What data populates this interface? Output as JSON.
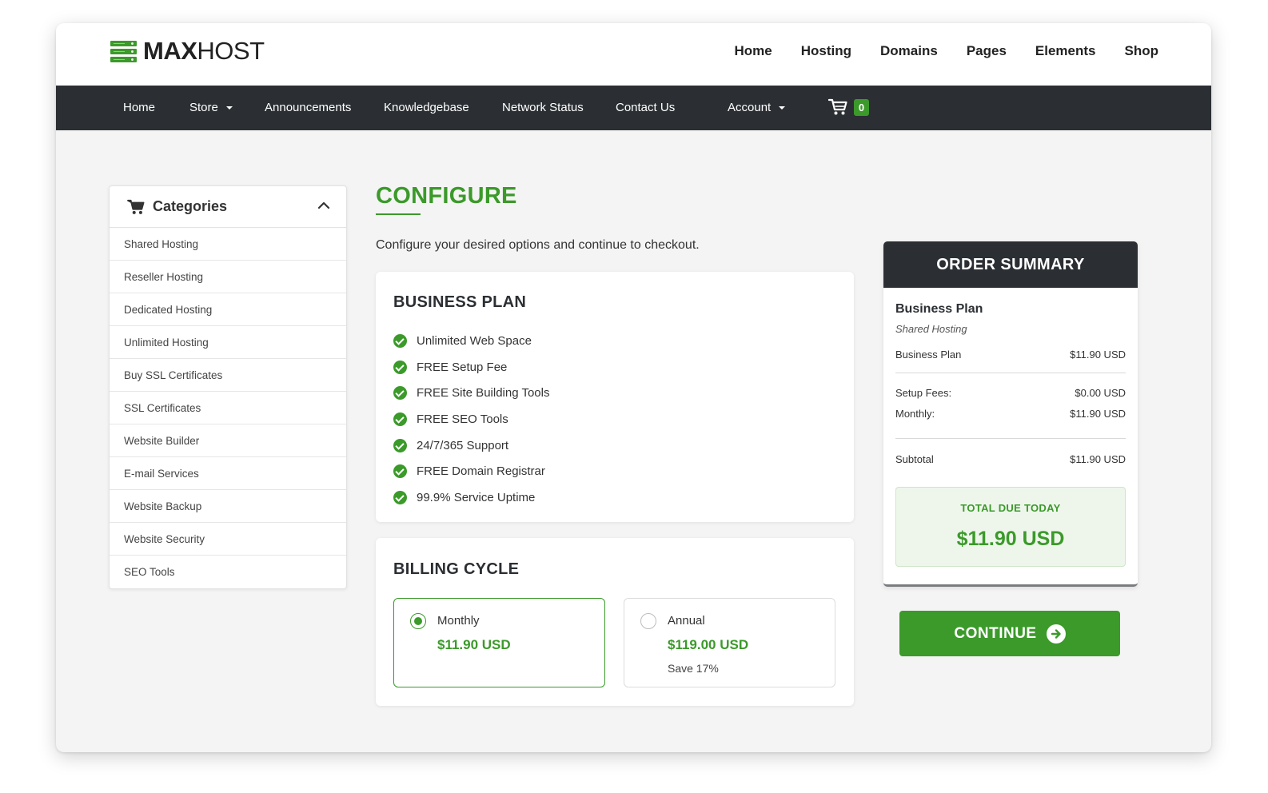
{
  "brand": {
    "name_bold": "MAX",
    "name_light": "HOST",
    "accent": "#3b9a2a",
    "dark": "#2b2f33",
    "icon": "server-logo-icon"
  },
  "topnav": [
    "Home",
    "Hosting",
    "Domains",
    "Pages",
    "Elements",
    "Shop"
  ],
  "darknav": {
    "home": "Home",
    "store": "Store",
    "announcements": "Announcements",
    "knowledgebase": "Knowledgebase",
    "network_status": "Network Status",
    "contact_us": "Contact Us",
    "account": "Account",
    "cart_count": "0",
    "cart_icon": "shopping-cart-icon"
  },
  "sidebar": {
    "title": "Categories",
    "items": [
      "Shared Hosting",
      "Reseller Hosting",
      "Dedicated Hosting",
      "Unlimited Hosting",
      "Buy SSL Certificates",
      "SSL Certificates",
      "Website Builder",
      "E-mail Services",
      "Website Backup",
      "Website Security",
      "SEO Tools"
    ]
  },
  "main": {
    "title": "CONFIGURE",
    "subtitle": "Configure your desired options and continue to checkout.",
    "plan": {
      "title": "BUSINESS PLAN",
      "features": [
        "Unlimited Web Space",
        "FREE Setup Fee",
        "FREE Site Building Tools",
        "FREE SEO Tools",
        "24/7/365 Support",
        "FREE Domain Registrar",
        "99.9% Service Uptime"
      ]
    },
    "billing": {
      "title": "BILLING CYCLE",
      "options": [
        {
          "name": "Monthly",
          "price": "$11.90 USD",
          "note": "",
          "selected": true
        },
        {
          "name": "Annual",
          "price": "$119.00 USD",
          "note": "Save 17%",
          "selected": false
        }
      ]
    }
  },
  "summary": {
    "title": "ORDER SUMMARY",
    "plan_name": "Business Plan",
    "plan_category": "Shared Hosting",
    "line_label": "Business Plan",
    "line_value": "$11.90 USD",
    "setup_label": "Setup Fees:",
    "setup_value": "$0.00 USD",
    "monthly_label": "Monthly:",
    "monthly_value": "$11.90 USD",
    "subtotal_label": "Subtotal",
    "subtotal_value": "$11.90 USD",
    "total_label": "TOTAL DUE TODAY",
    "total_value": "$11.90 USD"
  },
  "continue_label": "CONTINUE"
}
